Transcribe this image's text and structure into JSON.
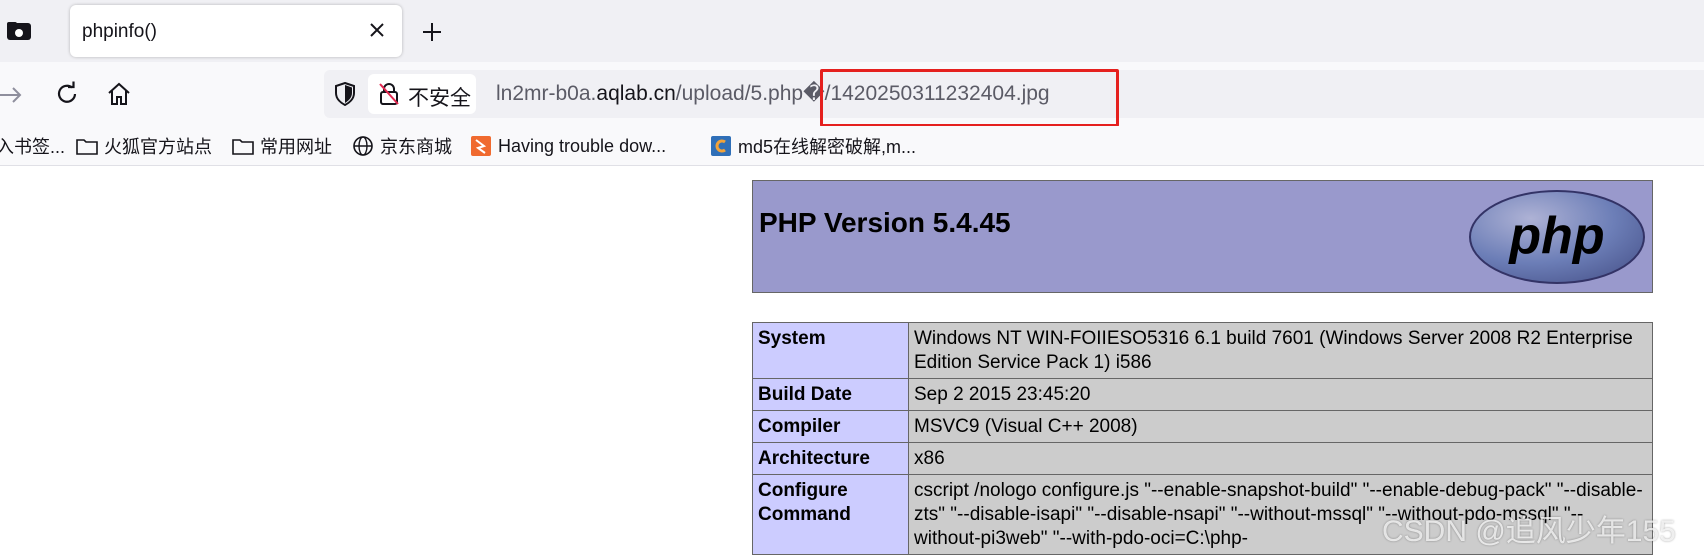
{
  "browser": {
    "tab": {
      "title": "phpinfo()"
    },
    "navbar": {
      "insecure_label": "不安全",
      "url_prefix": "ln2mr-b0a.",
      "url_domain": "aqlab.cn",
      "url_path": "/upload/5.php�/1420250311232404.jpg"
    },
    "bookmarks": [
      {
        "label": "入书签...",
        "icon": "bookmark-icon"
      },
      {
        "label": "火狐官方站点",
        "icon": "folder-icon"
      },
      {
        "label": "常用网址",
        "icon": "folder-icon"
      },
      {
        "label": "京东商城",
        "icon": "globe-icon"
      },
      {
        "label": "Having trouble dow...",
        "icon": "orange-puzzle-icon"
      },
      {
        "label": "md5在线解密破解,m...",
        "icon": "blue-c-icon"
      }
    ],
    "highlight_color": "#e5201e"
  },
  "phpinfo": {
    "version_title": "PHP Version 5.4.45",
    "logo_text": "php",
    "rows": [
      {
        "key": "System",
        "value": "Windows NT WIN-FOIIESO5316 6.1 build 7601 (Windows Server 2008 R2 Enterprise Edition Service Pack 1) i586"
      },
      {
        "key": "Build Date",
        "value": "Sep 2 2015 23:45:20"
      },
      {
        "key": "Compiler",
        "value": "MSVC9 (Visual C++ 2008)"
      },
      {
        "key": "Architecture",
        "value": "x86"
      },
      {
        "key": "Configure Command",
        "value": "cscript /nologo configure.js \"--enable-snapshot-build\" \"--enable-debug-pack\" \"--disable-zts\" \"--disable-isapi\" \"--disable-nsapi\" \"--without-mssql\" \"--without-pdo-mssql\" \"--without-pi3web\" \"--with-pdo-oci=C:\\php-"
      }
    ],
    "colors": {
      "header": "#9999cc",
      "key_cell": "#ccccff",
      "value_cell": "#cccccc"
    }
  },
  "watermark": "CSDN @追风少年155"
}
